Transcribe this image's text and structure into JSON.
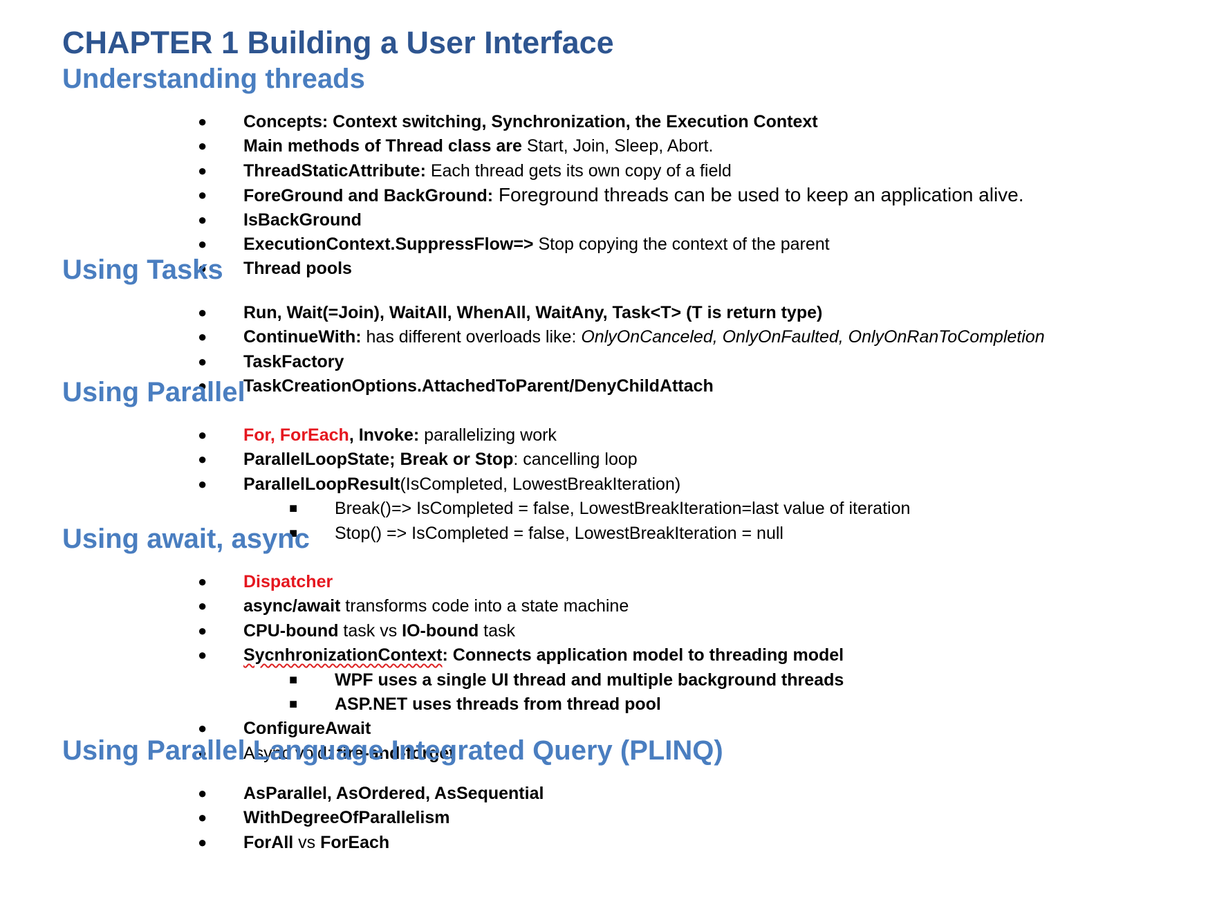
{
  "chapter_title": "CHAPTER 1 Building a User Interface",
  "bullet_glyph": "●",
  "sub_bullet_glyph": "■",
  "colors": {
    "chapter_title": "#2e5590",
    "section_heading": "#4a7ec0",
    "highlight_red": "#e5171f",
    "spellcheck_underline": "#dd2222"
  },
  "sections": [
    {
      "heading": "Understanding threads",
      "items": [
        {
          "segments": [
            {
              "text": "Concepts: Context switching, Synchronization, the Execution Context",
              "style": "bold"
            }
          ]
        },
        {
          "segments": [
            {
              "text": "Main methods of Thread class are",
              "style": "bold"
            },
            {
              "text": " Start, Join, Sleep, Abort.",
              "style": "normal"
            }
          ]
        },
        {
          "segments": [
            {
              "text": "ThreadStaticAttribute:",
              "style": "bold"
            },
            {
              "text": " Each thread gets its own copy of a field",
              "style": "normal"
            }
          ]
        },
        {
          "segments": [
            {
              "text": "ForeGround and BackGround:",
              "style": "bold"
            },
            {
              "text": " Foreground threads can be used to keep an application alive.",
              "style": "large"
            }
          ]
        },
        {
          "segments": [
            {
              "text": "IsBackGround",
              "style": "bold"
            }
          ]
        },
        {
          "segments": [
            {
              "text": "ExecutionContext.SuppressFlow=>",
              "style": "bold"
            },
            {
              "text": " Stop copying the context of the parent",
              "style": "normal"
            }
          ]
        },
        {
          "segments": [
            {
              "text": "Thread pools",
              "style": "bold"
            }
          ]
        }
      ]
    },
    {
      "heading": "Using Tasks",
      "items": [
        {
          "segments": [
            {
              "text": "Run, Wait(=Join), WaitAll, WhenAll, WaitAny, Task<T> (T is return type)",
              "style": "bold"
            }
          ]
        },
        {
          "segments": [
            {
              "text": "ContinueWith:",
              "style": "bold"
            },
            {
              "text": " has different overloads like: ",
              "style": "normal"
            },
            {
              "text": "OnlyOnCanceled, OnlyOnFaulted, OnlyOnRanToCompletion",
              "style": "italic"
            }
          ]
        },
        {
          "segments": [
            {
              "text": "TaskFactory",
              "style": "bold"
            }
          ]
        },
        {
          "segments": [
            {
              "text": "TaskCreationOptions.AttachedToParent/DenyChildAttach",
              "style": "bold"
            }
          ]
        }
      ]
    },
    {
      "heading": "Using Parallel",
      "items": [
        {
          "segments": [
            {
              "text": "For, ForEach",
              "style": "bold-red"
            },
            {
              "text": ", Invoke:",
              "style": "bold"
            },
            {
              "text": " parallelizing work",
              "style": "normal"
            }
          ]
        },
        {
          "segments": [
            {
              "text": "ParallelLoopState; Break or Stop",
              "style": "bold"
            },
            {
              "text": ": cancelling loop",
              "style": "normal"
            }
          ]
        },
        {
          "segments": [
            {
              "text": "ParallelLoopResult",
              "style": "bold"
            },
            {
              "text": "(IsCompleted, LowestBreakIteration)",
              "style": "normal"
            }
          ]
        },
        {
          "level": 2,
          "segments": [
            {
              "text": "Break()=> IsCompleted = false, LowestBreakIteration=last value of iteration",
              "style": "normal"
            }
          ]
        },
        {
          "level": 2,
          "segments": [
            {
              "text": "Stop()  => IsCompleted = false, LowestBreakIteration = null",
              "style": "normal"
            }
          ]
        }
      ]
    },
    {
      "heading": "Using await, async",
      "items": [
        {
          "segments": [
            {
              "text": "Dispatcher",
              "style": "bold-red"
            }
          ]
        },
        {
          "segments": [
            {
              "text": "async/await",
              "style": "bold"
            },
            {
              "text": " transforms code into a state machine",
              "style": "normal"
            }
          ]
        },
        {
          "segments": [
            {
              "text": "CPU-bound",
              "style": "bold"
            },
            {
              "text": " task vs ",
              "style": "normal"
            },
            {
              "text": "IO-bound",
              "style": "bold"
            },
            {
              "text": " task",
              "style": "normal"
            }
          ]
        },
        {
          "segments": [
            {
              "text": "SycnhronizationContext",
              "style": "bold-squiggle"
            },
            {
              "text": ": Connects application model to threading model",
              "style": "bold"
            }
          ]
        },
        {
          "level": 2,
          "segments": [
            {
              "text": "WPF uses a single UI thread and multiple background threads",
              "style": "bold"
            }
          ]
        },
        {
          "level": 2,
          "segments": [
            {
              "text": "ASP.NET uses threads from thread pool",
              "style": "bold"
            }
          ]
        },
        {
          "segments": [
            {
              "text": "ConfigureAwait",
              "style": "bold"
            }
          ]
        },
        {
          "segments": [
            {
              "text": "Async void: ",
              "style": "normal"
            },
            {
              "text": "fire-and-forget",
              "style": "bold"
            }
          ]
        }
      ]
    },
    {
      "heading": "Using Parallel Language Integrated Query (PLINQ)",
      "items": [
        {
          "segments": [
            {
              "text": "AsParallel, AsOrdered, AsSequential",
              "style": "bold"
            }
          ]
        },
        {
          "segments": [
            {
              "text": "WithDegreeOfParallelism",
              "style": "bold"
            }
          ]
        },
        {
          "segments": [
            {
              "text": "ForAll",
              "style": "bold"
            },
            {
              "text": " vs ",
              "style": "normal"
            },
            {
              "text": "ForEach",
              "style": "bold"
            }
          ]
        }
      ]
    }
  ]
}
